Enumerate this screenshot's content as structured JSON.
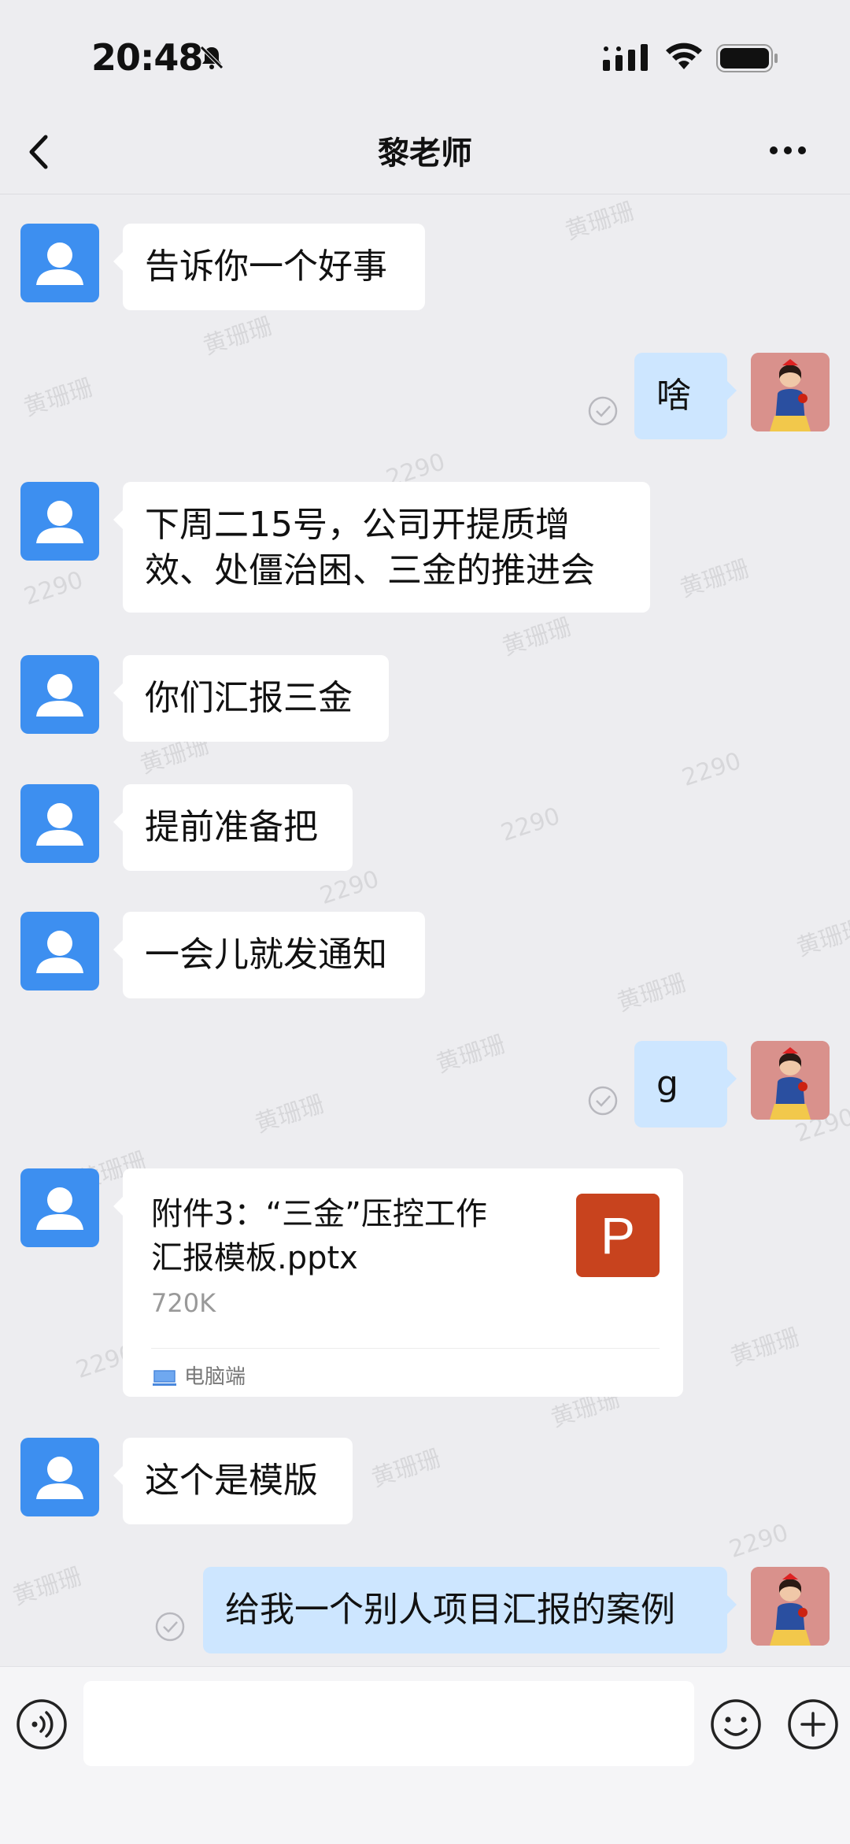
{
  "status_bar": {
    "time": "20:48"
  },
  "nav": {
    "title": "黎老师"
  },
  "watermark": {
    "name": "黄珊珊",
    "code": "2290"
  },
  "messages": [
    {
      "from": "contact",
      "text": "告诉你一个好事"
    },
    {
      "from": "me",
      "text": "啥",
      "read": true
    },
    {
      "from": "contact",
      "text_lines": [
        "下周二15号，公司开提质增",
        "效、处僵治困、三金的推进会"
      ]
    },
    {
      "from": "contact",
      "text": "你们汇报三金"
    },
    {
      "from": "contact",
      "text": "提前准备把"
    },
    {
      "from": "contact",
      "text": "一会儿就发通知"
    },
    {
      "from": "me",
      "text": "g",
      "read": true
    },
    {
      "from": "contact",
      "type": "file",
      "file": {
        "name_lines": [
          "附件3：“三金”压控工作",
          "汇报模板.pptx"
        ],
        "size": "720K",
        "icon_letter": "P",
        "source": "电脑端"
      }
    },
    {
      "from": "contact",
      "text": "这个是模版"
    },
    {
      "from": "me",
      "text": "给我一个别人项目汇报的案例",
      "read": true
    }
  ],
  "colors": {
    "background": "#EDEDF0",
    "incoming_bubble": "#FFFFFF",
    "outgoing_bubble": "#CDE6FF",
    "avatar_blue": "#3D8FF0",
    "ppt_red": "#C8431E"
  },
  "icons": {
    "back": "chevron-left-icon",
    "more": "more-dots-icon",
    "voice": "voice-icon",
    "emoji": "emoji-icon",
    "plus": "plus-icon"
  }
}
